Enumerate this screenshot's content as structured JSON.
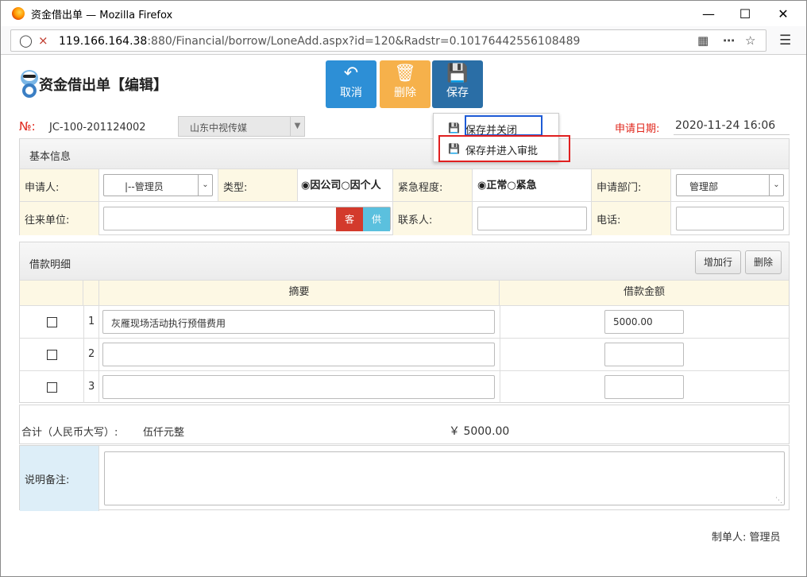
{
  "browser": {
    "title": "资金借出单 — Mozilla Firefox",
    "url_host": "119.166.164.38",
    "url_rest": ":880/Financial/borrow/LoneAdd.aspx?id=120&Radstr=0.10176442556108489"
  },
  "header": {
    "title": "资金借出单【编辑】",
    "buttons": {
      "cancel": "取消",
      "delete": "删除",
      "save": "保存"
    },
    "save_menu": [
      "保存并关闭",
      "保存并进入审批"
    ]
  },
  "meta": {
    "no_label": "№:",
    "no_value": "JC-100-201124002",
    "company": "山东中视传媒",
    "date_label": "申请日期:",
    "date_value": "2020-11-24 16:06"
  },
  "basic": {
    "section": "基本信息",
    "applicant_label": "申请人:",
    "applicant_value": "|--管理员",
    "type_label": "类型:",
    "type_options": "◉因公司○因个人",
    "urgency_label": "紧急程度:",
    "urgency_options": "◉正常○紧急",
    "dept_label": "申请部门:",
    "dept_value": "管理部",
    "partner_label": "往来单位:",
    "btn_customer": "客",
    "btn_supplier": "供",
    "contact_label": "联系人:",
    "phone_label": "电话:"
  },
  "detail": {
    "section": "借款明细",
    "add_row": "增加行",
    "delete": "删除",
    "col_summary": "摘要",
    "col_amount": "借款金额",
    "rows": [
      {
        "no": "1",
        "summary": "灰雁现场活动执行预借费用",
        "amount": "5000.00"
      },
      {
        "no": "2",
        "summary": "",
        "amount": ""
      },
      {
        "no": "3",
        "summary": "",
        "amount": ""
      }
    ]
  },
  "summary": {
    "label": "合计（人民币大写）:",
    "chinese": "伍仟元整",
    "amount": "￥ 5000.00"
  },
  "remark": {
    "label": "说明备注:"
  },
  "footer": {
    "creator": "制单人: 管理员"
  }
}
